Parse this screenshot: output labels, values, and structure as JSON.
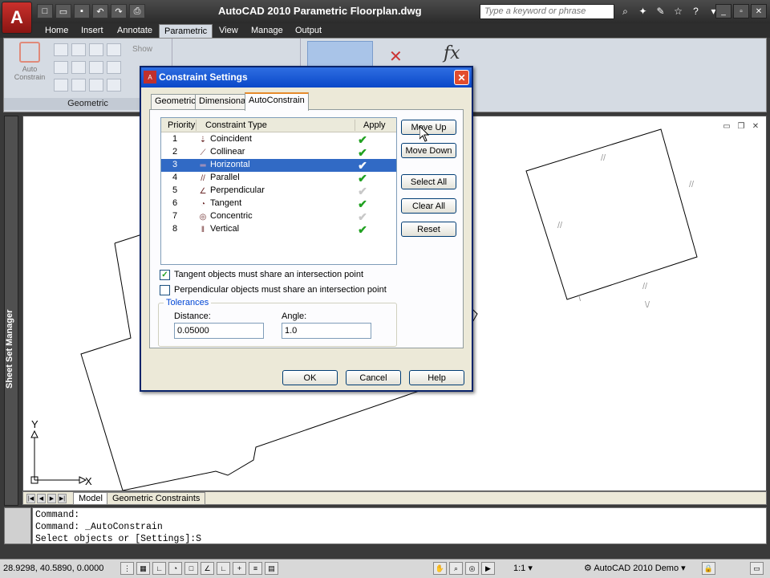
{
  "app": {
    "title": "AutoCAD 2010    Parametric Floorplan.dwg",
    "app_button": "A",
    "search_placeholder": "Type a keyword or phrase"
  },
  "ribbon": {
    "tabs": [
      "Home",
      "Insert",
      "Annotate",
      "Parametric",
      "View",
      "Manage",
      "Output"
    ],
    "active_tab": "Parametric",
    "panels": {
      "geometric": "Geometric",
      "auto_constrain": "Auto\nConstrain",
      "show": "Show"
    }
  },
  "side_palette": {
    "label": "Sheet Set Manager"
  },
  "drawing": {
    "layout_tabs": [
      "Model",
      "Geometric Constraints"
    ],
    "ucs_x": "X",
    "ucs_y": "Y"
  },
  "command_line": {
    "lines": [
      "Command:",
      "Command: _AutoConstrain",
      "Select objects or [Settings]:S"
    ]
  },
  "status_bar": {
    "coords": "28.9298, 40.5890, 0.0000",
    "scale": "1:1",
    "workspace": "AutoCAD 2010 Demo"
  },
  "dialog": {
    "title": "Constraint Settings",
    "tabs": [
      "Geometric",
      "Dimensional",
      "AutoConstrain"
    ],
    "active_tab": "AutoConstrain",
    "list_headers": {
      "priority": "Priority",
      "type": "Constraint Type",
      "apply": "Apply"
    },
    "rows": [
      {
        "priority": "1",
        "type": "Coincident",
        "apply": true,
        "icon": "coincident-icon"
      },
      {
        "priority": "2",
        "type": "Collinear",
        "apply": true,
        "icon": "collinear-icon"
      },
      {
        "priority": "3",
        "type": "Horizontal",
        "apply": true,
        "icon": "horizontal-icon",
        "selected": true
      },
      {
        "priority": "4",
        "type": "Parallel",
        "apply": true,
        "icon": "parallel-icon"
      },
      {
        "priority": "5",
        "type": "Perpendicular",
        "apply": false,
        "icon": "perpendicular-icon"
      },
      {
        "priority": "6",
        "type": "Tangent",
        "apply": true,
        "icon": "tangent-icon"
      },
      {
        "priority": "7",
        "type": "Concentric",
        "apply": false,
        "icon": "concentric-icon"
      },
      {
        "priority": "8",
        "type": "Vertical",
        "apply": true,
        "icon": "vertical-icon"
      }
    ],
    "side_buttons": [
      "Move Up",
      "Move Down",
      "Select All",
      "Clear All",
      "Reset"
    ],
    "checkbox_tangent": {
      "label": "Tangent objects must share an intersection point",
      "checked": true
    },
    "checkbox_perp": {
      "label": "Perpendicular objects must share an intersection point",
      "checked": false
    },
    "tolerances": {
      "group_label": "Tolerances",
      "distance_label": "Distance:",
      "distance_value": "0.05000",
      "angle_label": "Angle:",
      "angle_value": "1.0"
    },
    "footer_buttons": {
      "ok": "OK",
      "cancel": "Cancel",
      "help": "Help"
    }
  },
  "colors": {
    "selection": "#316ac5",
    "titlebar_blue": "#0a48c8",
    "check_green": "#21a121"
  }
}
